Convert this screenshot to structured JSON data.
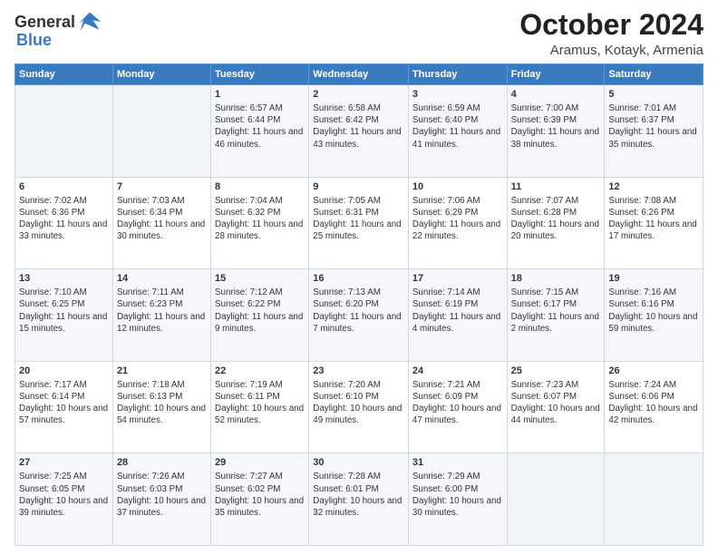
{
  "header": {
    "logo_general": "General",
    "logo_blue": "Blue",
    "month": "October 2024",
    "location": "Aramus, Kotayk, Armenia"
  },
  "days_of_week": [
    "Sunday",
    "Monday",
    "Tuesday",
    "Wednesday",
    "Thursday",
    "Friday",
    "Saturday"
  ],
  "weeks": [
    [
      {
        "day": null,
        "info": null
      },
      {
        "day": null,
        "info": null
      },
      {
        "day": "1",
        "info": "Sunrise: 6:57 AM\nSunset: 6:44 PM\nDaylight: 11 hours and 46 minutes."
      },
      {
        "day": "2",
        "info": "Sunrise: 6:58 AM\nSunset: 6:42 PM\nDaylight: 11 hours and 43 minutes."
      },
      {
        "day": "3",
        "info": "Sunrise: 6:59 AM\nSunset: 6:40 PM\nDaylight: 11 hours and 41 minutes."
      },
      {
        "day": "4",
        "info": "Sunrise: 7:00 AM\nSunset: 6:39 PM\nDaylight: 11 hours and 38 minutes."
      },
      {
        "day": "5",
        "info": "Sunrise: 7:01 AM\nSunset: 6:37 PM\nDaylight: 11 hours and 35 minutes."
      }
    ],
    [
      {
        "day": "6",
        "info": "Sunrise: 7:02 AM\nSunset: 6:36 PM\nDaylight: 11 hours and 33 minutes."
      },
      {
        "day": "7",
        "info": "Sunrise: 7:03 AM\nSunset: 6:34 PM\nDaylight: 11 hours and 30 minutes."
      },
      {
        "day": "8",
        "info": "Sunrise: 7:04 AM\nSunset: 6:32 PM\nDaylight: 11 hours and 28 minutes."
      },
      {
        "day": "9",
        "info": "Sunrise: 7:05 AM\nSunset: 6:31 PM\nDaylight: 11 hours and 25 minutes."
      },
      {
        "day": "10",
        "info": "Sunrise: 7:06 AM\nSunset: 6:29 PM\nDaylight: 11 hours and 22 minutes."
      },
      {
        "day": "11",
        "info": "Sunrise: 7:07 AM\nSunset: 6:28 PM\nDaylight: 11 hours and 20 minutes."
      },
      {
        "day": "12",
        "info": "Sunrise: 7:08 AM\nSunset: 6:26 PM\nDaylight: 11 hours and 17 minutes."
      }
    ],
    [
      {
        "day": "13",
        "info": "Sunrise: 7:10 AM\nSunset: 6:25 PM\nDaylight: 11 hours and 15 minutes."
      },
      {
        "day": "14",
        "info": "Sunrise: 7:11 AM\nSunset: 6:23 PM\nDaylight: 11 hours and 12 minutes."
      },
      {
        "day": "15",
        "info": "Sunrise: 7:12 AM\nSunset: 6:22 PM\nDaylight: 11 hours and 9 minutes."
      },
      {
        "day": "16",
        "info": "Sunrise: 7:13 AM\nSunset: 6:20 PM\nDaylight: 11 hours and 7 minutes."
      },
      {
        "day": "17",
        "info": "Sunrise: 7:14 AM\nSunset: 6:19 PM\nDaylight: 11 hours and 4 minutes."
      },
      {
        "day": "18",
        "info": "Sunrise: 7:15 AM\nSunset: 6:17 PM\nDaylight: 11 hours and 2 minutes."
      },
      {
        "day": "19",
        "info": "Sunrise: 7:16 AM\nSunset: 6:16 PM\nDaylight: 10 hours and 59 minutes."
      }
    ],
    [
      {
        "day": "20",
        "info": "Sunrise: 7:17 AM\nSunset: 6:14 PM\nDaylight: 10 hours and 57 minutes."
      },
      {
        "day": "21",
        "info": "Sunrise: 7:18 AM\nSunset: 6:13 PM\nDaylight: 10 hours and 54 minutes."
      },
      {
        "day": "22",
        "info": "Sunrise: 7:19 AM\nSunset: 6:11 PM\nDaylight: 10 hours and 52 minutes."
      },
      {
        "day": "23",
        "info": "Sunrise: 7:20 AM\nSunset: 6:10 PM\nDaylight: 10 hours and 49 minutes."
      },
      {
        "day": "24",
        "info": "Sunrise: 7:21 AM\nSunset: 6:09 PM\nDaylight: 10 hours and 47 minutes."
      },
      {
        "day": "25",
        "info": "Sunrise: 7:23 AM\nSunset: 6:07 PM\nDaylight: 10 hours and 44 minutes."
      },
      {
        "day": "26",
        "info": "Sunrise: 7:24 AM\nSunset: 6:06 PM\nDaylight: 10 hours and 42 minutes."
      }
    ],
    [
      {
        "day": "27",
        "info": "Sunrise: 7:25 AM\nSunset: 6:05 PM\nDaylight: 10 hours and 39 minutes."
      },
      {
        "day": "28",
        "info": "Sunrise: 7:26 AM\nSunset: 6:03 PM\nDaylight: 10 hours and 37 minutes."
      },
      {
        "day": "29",
        "info": "Sunrise: 7:27 AM\nSunset: 6:02 PM\nDaylight: 10 hours and 35 minutes."
      },
      {
        "day": "30",
        "info": "Sunrise: 7:28 AM\nSunset: 6:01 PM\nDaylight: 10 hours and 32 minutes."
      },
      {
        "day": "31",
        "info": "Sunrise: 7:29 AM\nSunset: 6:00 PM\nDaylight: 10 hours and 30 minutes."
      },
      {
        "day": null,
        "info": null
      },
      {
        "day": null,
        "info": null
      }
    ]
  ]
}
